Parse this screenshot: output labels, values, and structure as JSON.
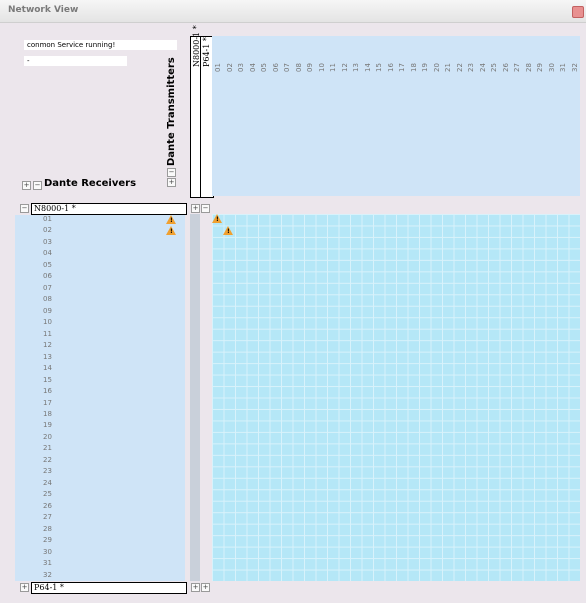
{
  "window": {
    "title": "Network View"
  },
  "status": {
    "line1": "conmon Service running!",
    "line2": "-"
  },
  "headers": {
    "transmitters": "Dante Transmitters",
    "receivers": "Dante Receivers"
  },
  "tx_devices": [
    "N8000-1 *",
    "P64-1 *"
  ],
  "tx_channels": [
    "01",
    "02",
    "03",
    "04",
    "05",
    "06",
    "07",
    "08",
    "09",
    "10",
    "11",
    "12",
    "13",
    "14",
    "15",
    "16",
    "17",
    "18",
    "19",
    "20",
    "21",
    "22",
    "23",
    "24",
    "25",
    "26",
    "27",
    "28",
    "29",
    "30",
    "31",
    "32"
  ],
  "rx_devices": [
    "N8000-1 *",
    "P64-1 *"
  ],
  "rx_channels": [
    "01",
    "02",
    "03",
    "04",
    "05",
    "06",
    "07",
    "08",
    "09",
    "10",
    "11",
    "12",
    "13",
    "14",
    "15",
    "16",
    "17",
    "18",
    "19",
    "20",
    "21",
    "22",
    "23",
    "24",
    "25",
    "26",
    "27",
    "28",
    "29",
    "30",
    "31",
    "32"
  ],
  "icons": {
    "plus": "+",
    "minus": "−",
    "warning_glyph": "!"
  },
  "colors": {
    "grid": "#b5e7f7",
    "panel": "#cfe4f7",
    "warning": "#f0a030"
  }
}
